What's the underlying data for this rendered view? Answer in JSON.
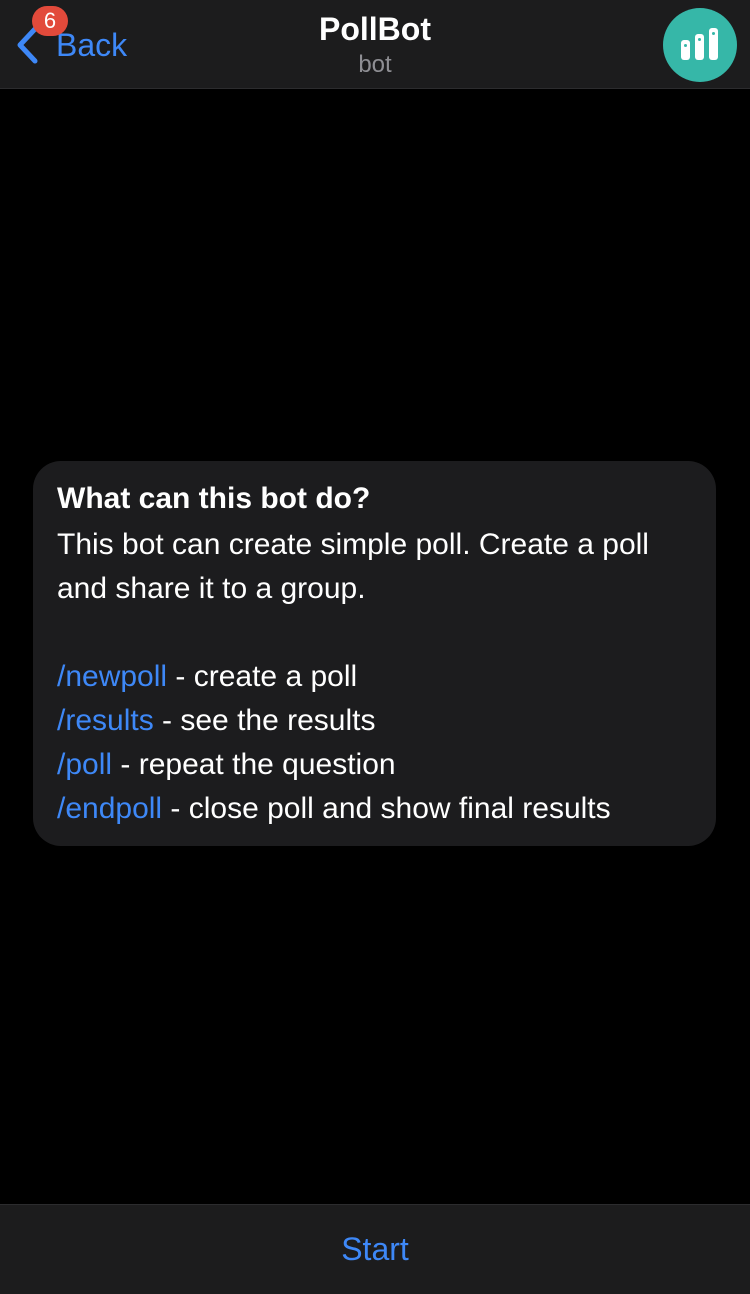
{
  "header": {
    "back_label": "Back",
    "badge_count": "6",
    "title": "PollBot",
    "subtitle": "bot",
    "avatar_icon": "bar-chart-icon",
    "avatar_color": "#36b7a8"
  },
  "info_card": {
    "title": "What can this bot do?",
    "description": "This bot can create simple poll. Create a poll and share it to a group.",
    "commands": [
      {
        "command": "/newpoll",
        "text": " - create a poll"
      },
      {
        "command": "/results",
        "text": " - see the results"
      },
      {
        "command": "/poll",
        "text": " - repeat the question"
      },
      {
        "command": "/endpoll",
        "text": " - close poll and show final results"
      }
    ]
  },
  "bottom_bar": {
    "start_label": "Start"
  },
  "colors": {
    "accent": "#3e88f7",
    "badge": "#e24a3b",
    "bar_background": "#1c1c1d",
    "card_background": "#1c1c1e",
    "background": "#000000"
  }
}
